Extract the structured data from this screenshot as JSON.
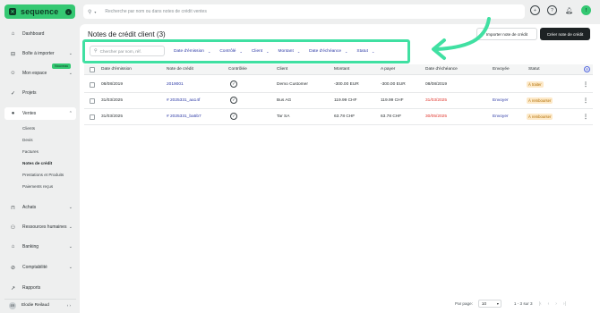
{
  "app": {
    "brand": "sequence",
    "brand_badge": "±",
    "search_placeholder": "Recherche par nom ou dans notes de crédit ventes"
  },
  "sidebar": {
    "items": [
      {
        "label": "Dashboard",
        "icon": "home-icon"
      },
      {
        "label": "Boîte à importer",
        "icon": "inbox-icon",
        "badge": "Nouveau"
      },
      {
        "label": "Mon espace",
        "icon": "person-icon"
      },
      {
        "label": "Projets",
        "icon": "check-icon"
      },
      {
        "label": "Ventes",
        "icon": "sales-icon"
      },
      {
        "label": "Achats",
        "icon": "bag-icon"
      },
      {
        "label": "Ressources humaines",
        "icon": "people-icon"
      },
      {
        "label": "Banking",
        "icon": "bank-icon"
      },
      {
        "label": "Comptabilité",
        "icon": "ledger-icon"
      },
      {
        "label": "Rapports",
        "icon": "chart-icon"
      }
    ],
    "sub_items": [
      "Clients",
      "Devis",
      "Factures",
      "Notes de crédit",
      "Prestations et Produits",
      "Paiements reçus"
    ],
    "user": {
      "initials": "ER",
      "name": "Elodie Reilaud"
    }
  },
  "main": {
    "title": "Notes de crédit client (3)",
    "import_button": "Importer note de crédit",
    "create_button": "Créer note de crédit",
    "filter_search_placeholder": "Chercher par nom, réf.",
    "filters": [
      "Date d'émission",
      "Contrôlé",
      "Client",
      "Montant",
      "Date d'échéance",
      "Statut"
    ],
    "columns": [
      "Date d'émission",
      "Note de crédit",
      "Contrôlée",
      "Client",
      "Montant",
      "A payer",
      "Date d'échéance",
      "Envoyée",
      "Statut"
    ],
    "rows": [
      {
        "date": "08/08/2019",
        "note": "2019001",
        "client": "Demo Customer",
        "amount": "-300.00 EUR",
        "topay": "-300.00 EUR",
        "due": "08/08/2019",
        "due_red": false,
        "sent": "",
        "status": "À traiter"
      },
      {
        "date": "31/03/2025",
        "note": "# 2025331_aa14f",
        "client": "Bus AG",
        "amount": "119.99 CHF",
        "topay": "119.99 CHF",
        "due": "31/03/2025",
        "due_red": true,
        "sent": "Envoyer",
        "status": "À rembourser"
      },
      {
        "date": "31/03/2025",
        "note": "# 2025331_ba5b7",
        "client": "Tar SA",
        "amount": "63.78 CHF",
        "topay": "63.78 CHF",
        "due": "30/05/2025",
        "due_red": true,
        "sent": "Envoyer",
        "status": "À rembourser"
      }
    ],
    "pager": {
      "label": "Par page:",
      "per_page": "10",
      "range": "1 - 3 sur 3"
    }
  },
  "colors": {
    "brand": "#34c872",
    "highlight": "#40e0a2",
    "link": "#2e3ba6",
    "danger": "#e0342b"
  }
}
